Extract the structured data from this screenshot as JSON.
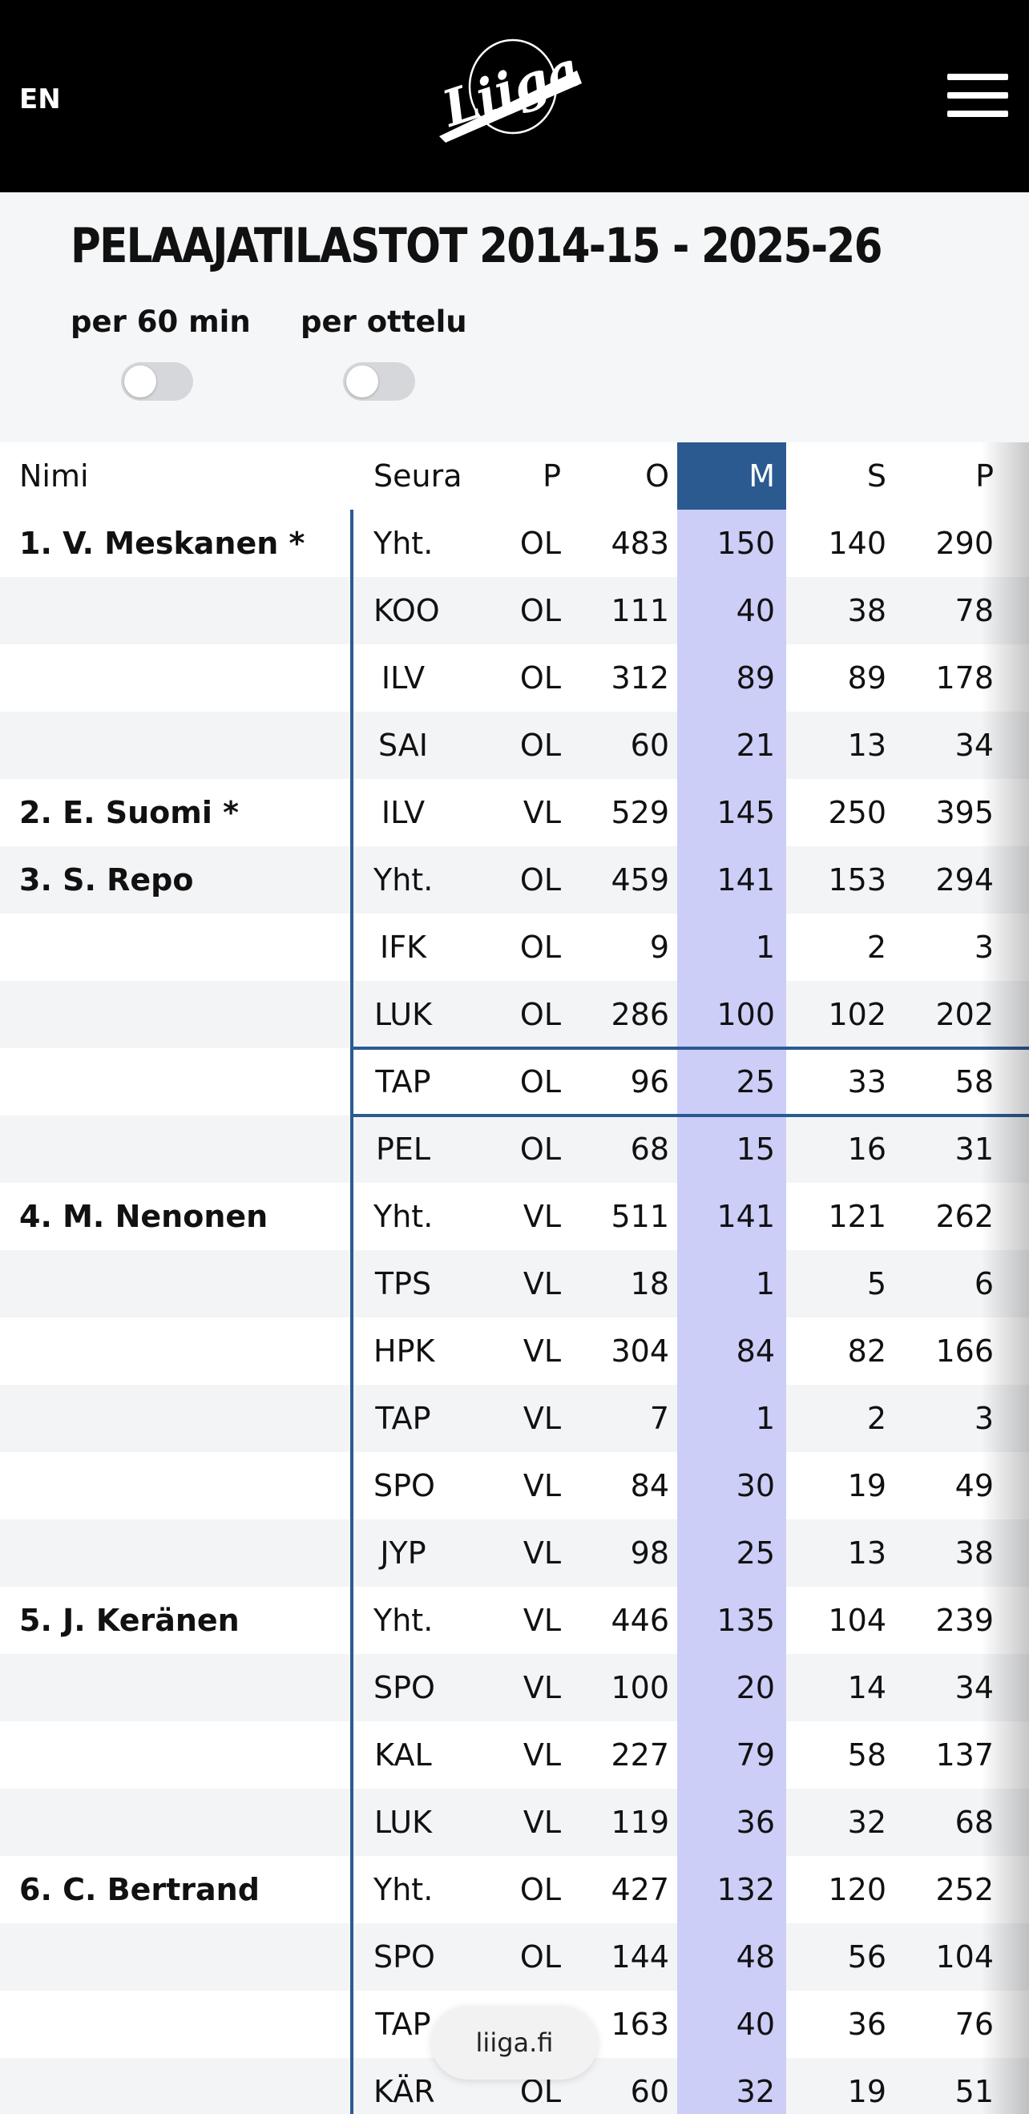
{
  "header": {
    "language": "EN",
    "logo_text": "Liiga",
    "menu_icon": "hamburger-menu-icon"
  },
  "page_title": "PELAAJATILASTOT 2014-15 - 2025-26",
  "toggles": [
    {
      "label": "per 60 min",
      "on": false
    },
    {
      "label": "per ottelu",
      "on": false
    }
  ],
  "table": {
    "columns": {
      "name": "Nimi",
      "club": "Seura",
      "pos": "P",
      "gp": "O",
      "g": "M",
      "a": "S",
      "p": "P"
    },
    "sorted_column": "M",
    "rows": [
      {
        "name": "1.  V. Meskanen *",
        "club": "Yht.",
        "pos": "OL",
        "gp": "483",
        "g": "150",
        "a": "140",
        "p": "290"
      },
      {
        "name": "",
        "club": "KOO",
        "pos": "OL",
        "gp": "111",
        "g": "40",
        "a": "38",
        "p": "78"
      },
      {
        "name": "",
        "club": "ILV",
        "pos": "OL",
        "gp": "312",
        "g": "89",
        "a": "89",
        "p": "178"
      },
      {
        "name": "",
        "club": "SAI",
        "pos": "OL",
        "gp": "60",
        "g": "21",
        "a": "13",
        "p": "34"
      },
      {
        "name": "2.  E. Suomi *",
        "club": "ILV",
        "pos": "VL",
        "gp": "529",
        "g": "145",
        "a": "250",
        "p": "395"
      },
      {
        "name": "3.  S. Repo",
        "club": "Yht.",
        "pos": "OL",
        "gp": "459",
        "g": "141",
        "a": "153",
        "p": "294"
      },
      {
        "name": "",
        "club": "IFK",
        "pos": "OL",
        "gp": "9",
        "g": "1",
        "a": "2",
        "p": "3"
      },
      {
        "name": "",
        "club": "LUK",
        "pos": "OL",
        "gp": "286",
        "g": "100",
        "a": "102",
        "p": "202"
      },
      {
        "name": "",
        "club": "TAP",
        "pos": "OL",
        "gp": "96",
        "g": "25",
        "a": "33",
        "p": "58"
      },
      {
        "name": "",
        "club": "PEL",
        "pos": "OL",
        "gp": "68",
        "g": "15",
        "a": "16",
        "p": "31"
      },
      {
        "name": "4.  M. Nenonen",
        "club": "Yht.",
        "pos": "VL",
        "gp": "511",
        "g": "141",
        "a": "121",
        "p": "262"
      },
      {
        "name": "",
        "club": "TPS",
        "pos": "VL",
        "gp": "18",
        "g": "1",
        "a": "5",
        "p": "6"
      },
      {
        "name": "",
        "club": "HPK",
        "pos": "VL",
        "gp": "304",
        "g": "84",
        "a": "82",
        "p": "166"
      },
      {
        "name": "",
        "club": "TAP",
        "pos": "VL",
        "gp": "7",
        "g": "1",
        "a": "2",
        "p": "3"
      },
      {
        "name": "",
        "club": "SPO",
        "pos": "VL",
        "gp": "84",
        "g": "30",
        "a": "19",
        "p": "49"
      },
      {
        "name": "",
        "club": "JYP",
        "pos": "VL",
        "gp": "98",
        "g": "25",
        "a": "13",
        "p": "38"
      },
      {
        "name": "5.  J. Keränen",
        "club": "Yht.",
        "pos": "VL",
        "gp": "446",
        "g": "135",
        "a": "104",
        "p": "239"
      },
      {
        "name": "",
        "club": "SPO",
        "pos": "VL",
        "gp": "100",
        "g": "20",
        "a": "14",
        "p": "34"
      },
      {
        "name": "",
        "club": "KAL",
        "pos": "VL",
        "gp": "227",
        "g": "79",
        "a": "58",
        "p": "137"
      },
      {
        "name": "",
        "club": "LUK",
        "pos": "VL",
        "gp": "119",
        "g": "36",
        "a": "32",
        "p": "68"
      },
      {
        "name": "6.  C. Bertrand",
        "club": "Yht.",
        "pos": "OL",
        "gp": "427",
        "g": "132",
        "a": "120",
        "p": "252"
      },
      {
        "name": "",
        "club": "SPO",
        "pos": "OL",
        "gp": "144",
        "g": "48",
        "a": "56",
        "p": "104"
      },
      {
        "name": "",
        "club": "TAP",
        "pos": "OL",
        "gp": "163",
        "g": "40",
        "a": "36",
        "p": "76"
      },
      {
        "name": "",
        "club": "KÄR",
        "pos": "OL",
        "gp": "60",
        "g": "32",
        "a": "19",
        "p": "51"
      }
    ]
  },
  "browser": {
    "url": "liiga.fi"
  },
  "colors": {
    "header_bg": "#000000",
    "accent_blue": "#2b5a91",
    "highlight_column": "#cccef8"
  }
}
